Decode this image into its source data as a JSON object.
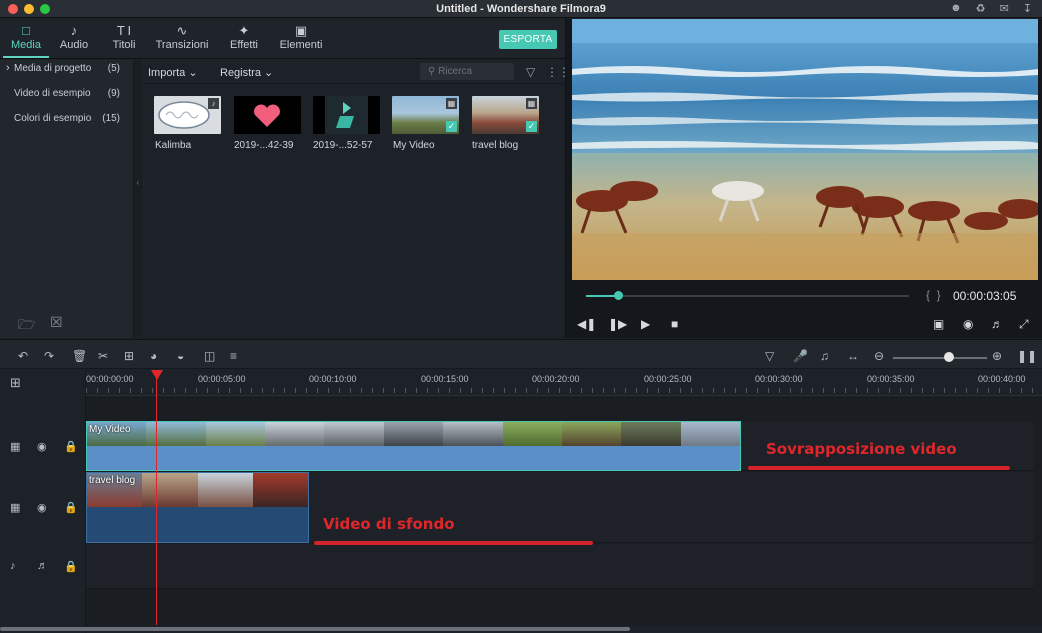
{
  "window": {
    "title": "Untitled - Wondershare Filmora9"
  },
  "tabs": [
    {
      "label": "Media",
      "icon": "folder-icon"
    },
    {
      "label": "Audio",
      "icon": "music-note-icon"
    },
    {
      "label": "Titoli",
      "icon": "text-icon"
    },
    {
      "label": "Transizioni",
      "icon": "transition-icon"
    },
    {
      "label": "Effetti",
      "icon": "effects-icon"
    },
    {
      "label": "Elementi",
      "icon": "image-icon"
    }
  ],
  "export_label": "ESPORTA",
  "sidebar": {
    "items": [
      {
        "label": "Media di progetto",
        "count": "(5)"
      },
      {
        "label": "Video di esempio",
        "count": "(9)"
      },
      {
        "label": "Colori di esempio",
        "count": "(15)"
      }
    ]
  },
  "media_toolbar": {
    "import_label": "Importa",
    "record_label": "Registra",
    "search_placeholder": "Ricerca"
  },
  "media_items": [
    {
      "label": "Kalimba",
      "badge": "music-note-icon"
    },
    {
      "label": "2019-...42-39"
    },
    {
      "label": "2019-...52-57"
    },
    {
      "label": "My Video",
      "badge": "film-icon",
      "checked": true
    },
    {
      "label": "travel blog",
      "badge": "film-icon",
      "checked": true
    }
  ],
  "preview": {
    "time": "00:00:03:05",
    "progress": 0.1
  },
  "timeline": {
    "ruler": [
      "00:00:00:00",
      "00:00:05:00",
      "00:00:10:00",
      "00:00:15:00",
      "00:00:20:00",
      "00:00:25:00",
      "00:00:30:00",
      "00:00:35:00",
      "00:00:40:00"
    ],
    "zoom_level": 0.6,
    "clips": [
      {
        "name": "My Video",
        "track": 1
      },
      {
        "name": "travel blog",
        "track": 2
      }
    ]
  },
  "annotations": {
    "overlay": "Sovrapposizione video",
    "background": "Video di sfondo"
  },
  "colors": {
    "accent": "#46c8b3",
    "annotation": "#e0262b",
    "playhead": "#e0262b"
  }
}
